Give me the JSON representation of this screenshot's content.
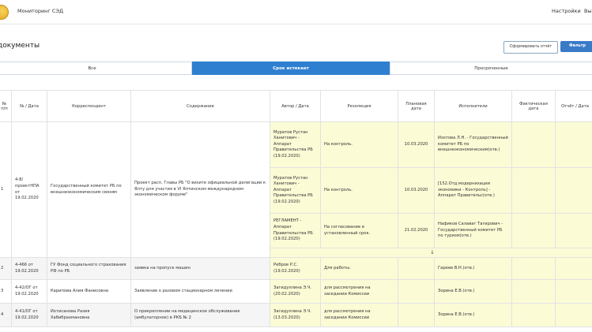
{
  "header": {
    "app_title": "Мониторинг СЭД",
    "nav_settings": "Настройки",
    "nav_exit": "Вы"
  },
  "page": {
    "title": "документы"
  },
  "toolbar": {
    "report_label": "Сформировать отчёт",
    "filter_label": "Фильтр"
  },
  "tabs": [
    {
      "label": "Все",
      "active": false
    },
    {
      "label": "Срок истекает",
      "active": true
    },
    {
      "label": "Просроченные",
      "active": false
    }
  ],
  "table": {
    "headers": {
      "num": "№ п/п",
      "reg": "№ / Дата",
      "correspondent": "Корреспондент",
      "content": "Содержание",
      "author": "Автор / Дата",
      "resolution": "Резолюция",
      "planned": "Плановая дата",
      "executors": "Исполнители",
      "actual": "Фактическая дата",
      "report": "Отчёт / Дата"
    },
    "row1": {
      "num": "1",
      "reg": "4-8/ проектНПА от 19.02.2020",
      "correspondent": "Государственный комитет РБ по внешнеэкономическим связям",
      "content": "Проект расп. Главы РБ \"О визите официальной делегации к Ялту для участия в VI Ялтинском международном экономическом форуме\"",
      "subs": [
        {
          "author": "Муратов Рустан Ханитович - Аппарат Правительства РБ (19.02.2020)",
          "resolution": "На контроль.",
          "planned": "10.03.2020",
          "executors": "Изотова Л.Н. - Государственный комитет РБ по внешнеэкономическим(отв.)"
        },
        {
          "author": "Муратов Рустан Ханитович - Аппарат Правительства РБ (19.02.2020)",
          "resolution": "На контроль.",
          "planned": "10.03.2020",
          "executors": "[152.Отд.модернизации экономики - Контроль] - Аппарат Правительс(отв.)"
        },
        {
          "author": "РЕГЛАМЕНТ - Аппарат Правительства РБ (19.02.2020)",
          "resolution": "На согласование в установленный срок.",
          "planned": "21.02.2020",
          "executors": "Нафиков Салават Тагирович - Государственный комитет РБ по туризм(отв.)"
        }
      ],
      "expand_icon": "↓"
    },
    "rows": [
      {
        "num": "2",
        "reg": "4-466 от 19.02.2020",
        "correspondent": "ГУ Фонд социального страхования РФ по РБ",
        "content": "заявка на пропуск машин",
        "author": "Ребров Р.С. (19.02.2020)",
        "resolution": "Для работы.",
        "planned": "",
        "executors": "Гареев В.Н.(отв.)"
      },
      {
        "num": "3",
        "reg": "4-42/ОГ от 19.02.2020",
        "correspondent": "Карипова Алия Фанисовна",
        "content": "Заявление о разовом стационарном лечении",
        "author": "Загидуллина Э.Ч. (20.02.2020)",
        "resolution": "для рассмотрения на заседании Комиссии",
        "planned": "",
        "executors": "Зорина Е.В.(отв.)"
      },
      {
        "num": "4",
        "reg": "4-41/ОГ от 19.02.2020",
        "correspondent": "Ихтисанова Разия Хабибрахмановна",
        "content": "О прикреплении на медицинское обслуживание (амбулаторное) в РКБ № 2",
        "author": "Загидуллина Э.Ч. (13.03.2020)",
        "resolution": "для рассмотрения на заседании Комиссии",
        "planned": "",
        "executors": "Зорина Е.В.(отв.)"
      }
    ]
  }
}
